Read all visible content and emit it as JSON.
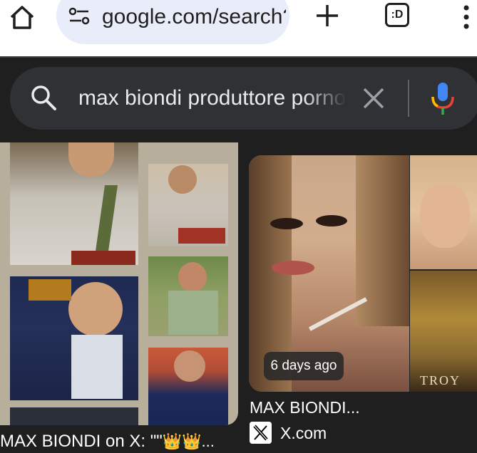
{
  "browser": {
    "url": "google.com/search?q=max+biondi+produttore",
    "tab_switcher_label": ":D"
  },
  "search": {
    "query": "max biondi produttore porno"
  },
  "results": [
    {
      "title": "MAX BIONDI on X: \"\"",
      "title_suffix": "👑👑...",
      "image_desc": "collage of photos of a man"
    },
    {
      "time_badge": "6 days ago",
      "title": "MAX BIONDI...",
      "source": "X.com",
      "image_desc": "woman portrait and movie poster",
      "poster_text": "TROY"
    }
  ],
  "colors": {
    "page_bg": "#1f1f1f",
    "search_bg": "#303134",
    "chrome_bg": "#ffffff",
    "url_pill_bg": "#e8edf9"
  }
}
